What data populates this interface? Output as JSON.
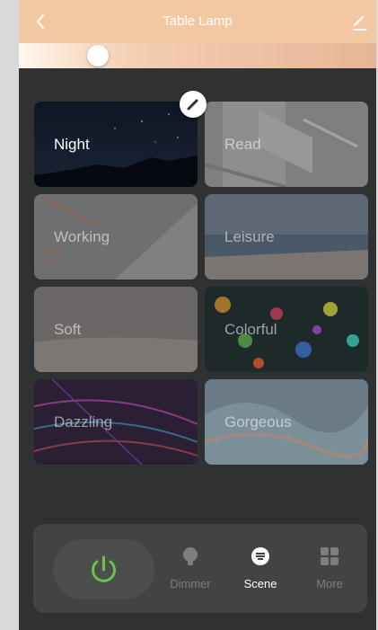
{
  "header": {
    "title": "Table Lamp",
    "back_icon": "chevron-left-icon",
    "edit_icon": "pencil-icon",
    "color": "#f2c8a2"
  },
  "brightness": {
    "value": 0.22
  },
  "scenes": [
    {
      "label": "Night",
      "active": true
    },
    {
      "label": "Read",
      "active": false
    },
    {
      "label": "Working",
      "active": false
    },
    {
      "label": "Leisure",
      "active": false
    },
    {
      "label": "Soft",
      "active": false
    },
    {
      "label": "Colorful",
      "active": false
    },
    {
      "label": "Dazzling",
      "active": false
    },
    {
      "label": "Gorgeous",
      "active": false
    }
  ],
  "bottom_bar": {
    "power_icon": "power-icon",
    "power_color": "#6fbf4a",
    "tabs": [
      {
        "label": "Dimmer",
        "icon": "bulb-icon",
        "active": false
      },
      {
        "label": "Scene",
        "icon": "scene-icon",
        "active": true
      },
      {
        "label": "More",
        "icon": "grid-icon",
        "active": false
      }
    ]
  }
}
